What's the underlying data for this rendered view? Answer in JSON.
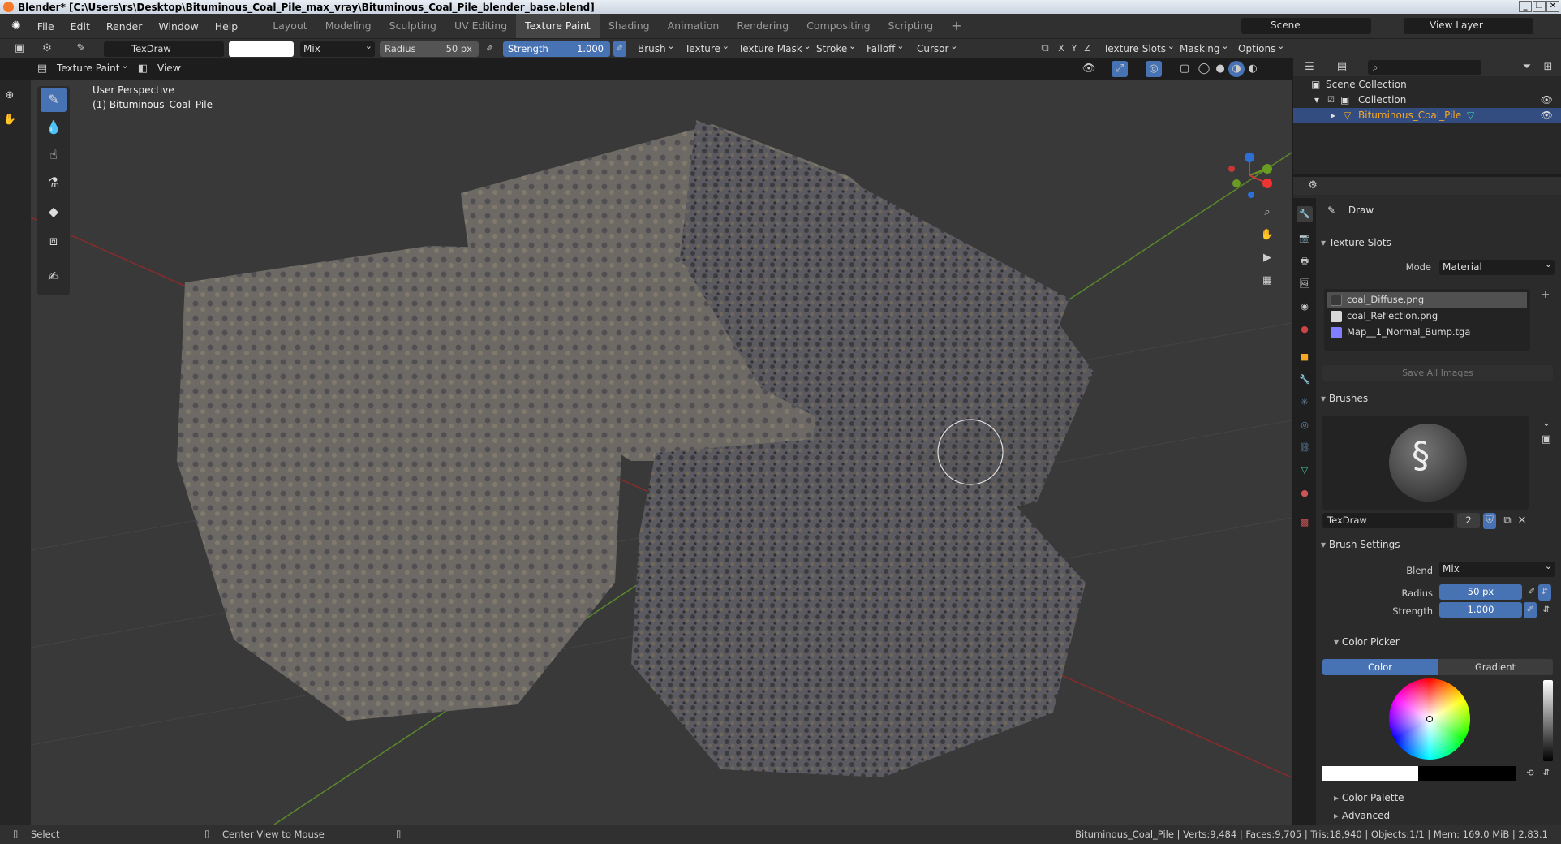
{
  "window": {
    "title": "Blender* [C:\\Users\\rs\\Desktop\\Bituminous_Coal_Pile_max_vray\\Bituminous_Coal_Pile_blender_base.blend]"
  },
  "menu": [
    "File",
    "Edit",
    "Render",
    "Window",
    "Help"
  ],
  "workspaces": [
    "Layout",
    "Modeling",
    "Sculpting",
    "UV Editing",
    "Texture Paint",
    "Shading",
    "Animation",
    "Rendering",
    "Compositing",
    "Scripting"
  ],
  "active_workspace": "Texture Paint",
  "scene": {
    "name": "Scene",
    "view_layer": "View Layer"
  },
  "tool_header": {
    "brush_name": "TexDraw",
    "blend": "Mix",
    "radius_label": "Radius",
    "radius_value": "50 px",
    "strength_label": "Strength",
    "strength_value": "1.000",
    "menus": [
      "Brush",
      "Texture",
      "Texture Mask",
      "Stroke",
      "Falloff",
      "Cursor"
    ],
    "axes": [
      "X",
      "Y",
      "Z"
    ],
    "right_menus": [
      "Texture Slots",
      "Masking",
      "Options"
    ]
  },
  "viewport_header": {
    "mode": "Texture Paint",
    "view": "View"
  },
  "viewport": {
    "perspective": "User Perspective",
    "object": "(1) Bituminous_Coal_Pile"
  },
  "outliner": {
    "scene_collection": "Scene Collection",
    "collection": "Collection",
    "object": "Bituminous_Coal_Pile"
  },
  "properties": {
    "tool_name": "Draw",
    "texture_slots": {
      "title": "Texture Slots",
      "mode_label": "Mode",
      "mode_value": "Material",
      "slots": [
        {
          "name": "coal_Diffuse.png",
          "color": "#3a3a3a"
        },
        {
          "name": "coal_Reflection.png",
          "color": "#d8d8d8"
        },
        {
          "name": "Map__1_Normal_Bump.tga",
          "color": "#7f7fff"
        }
      ],
      "save_all": "Save All Images"
    },
    "brushes": {
      "title": "Brushes",
      "name": "TexDraw",
      "users": "2"
    },
    "brush_settings": {
      "title": "Brush Settings",
      "blend_label": "Blend",
      "blend_value": "Mix",
      "radius_label": "Radius",
      "radius_value": "50 px",
      "strength_label": "Strength",
      "strength_value": "1.000"
    },
    "color_picker": {
      "title": "Color Picker",
      "tab_color": "Color",
      "tab_gradient": "Gradient"
    },
    "color_palette": "Color Palette",
    "advanced": "Advanced"
  },
  "status": {
    "select": "Select",
    "center_view": "Center View to Mouse",
    "stats": "Bituminous_Coal_Pile | Verts:9,484 | Faces:9,705 | Tris:18,940 | Objects:1/1 | Mem: 169.0 MiB | 2.83.1"
  },
  "colors": {
    "accent": "#4772b3",
    "active_object": "#f5a623",
    "bg": "#393939"
  }
}
